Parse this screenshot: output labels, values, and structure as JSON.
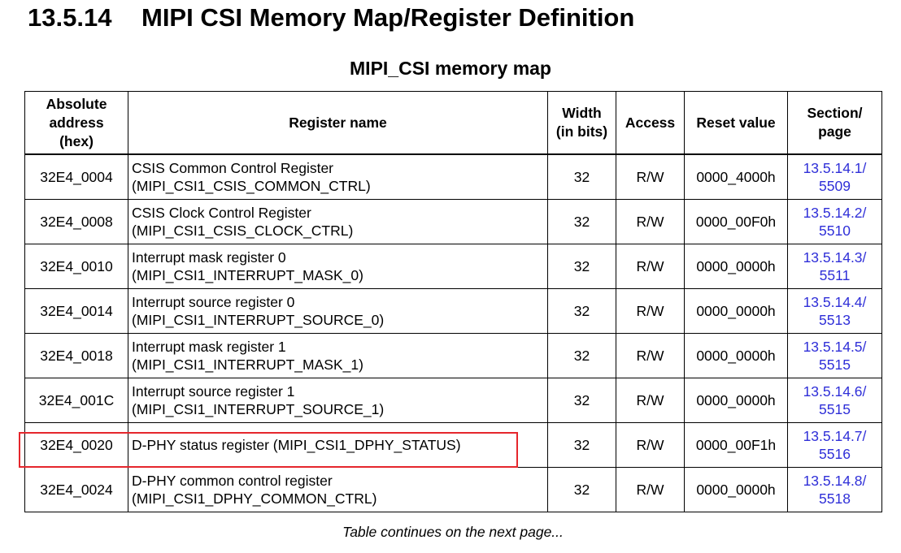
{
  "heading": {
    "number": "13.5.14",
    "title": "MIPI CSI Memory Map/Register Definition"
  },
  "table": {
    "caption": "MIPI_CSI memory map",
    "headers": {
      "address": [
        "Absolute",
        "address",
        "(hex)"
      ],
      "name": "Register name",
      "width": [
        "Width",
        "(in bits)"
      ],
      "access": "Access",
      "reset": "Reset value",
      "section": [
        "Section/",
        "page"
      ]
    },
    "rows": [
      {
        "address": "32E4_0004",
        "name": [
          "CSIS Common Control Register",
          "(MIPI_CSI1_CSIS_COMMON_CTRL)"
        ],
        "width": "32",
        "access": "R/W",
        "reset": "0000_4000h",
        "section": [
          "13.5.14.1/",
          "5509"
        ]
      },
      {
        "address": "32E4_0008",
        "name": [
          "CSIS Clock Control Register",
          "(MIPI_CSI1_CSIS_CLOCK_CTRL)"
        ],
        "width": "32",
        "access": "R/W",
        "reset": "0000_00F0h",
        "section": [
          "13.5.14.2/",
          "5510"
        ]
      },
      {
        "address": "32E4_0010",
        "name": [
          "Interrupt mask register 0",
          "(MIPI_CSI1_INTERRUPT_MASK_0)"
        ],
        "width": "32",
        "access": "R/W",
        "reset": "0000_0000h",
        "section": [
          "13.5.14.3/",
          "5511"
        ]
      },
      {
        "address": "32E4_0014",
        "name": [
          "Interrupt source register 0",
          "(MIPI_CSI1_INTERRUPT_SOURCE_0)"
        ],
        "width": "32",
        "access": "R/W",
        "reset": "0000_0000h",
        "section": [
          "13.5.14.4/",
          "5513"
        ]
      },
      {
        "address": "32E4_0018",
        "name": [
          "Interrupt mask register 1",
          "(MIPI_CSI1_INTERRUPT_MASK_1)"
        ],
        "width": "32",
        "access": "R/W",
        "reset": "0000_0000h",
        "section": [
          "13.5.14.5/",
          "5515"
        ]
      },
      {
        "address": "32E4_001C",
        "name": [
          "Interrupt source register 1",
          "(MIPI_CSI1_INTERRUPT_SOURCE_1)"
        ],
        "width": "32",
        "access": "R/W",
        "reset": "0000_0000h",
        "section": [
          "13.5.14.6/",
          "5515"
        ]
      },
      {
        "address": "32E4_0020",
        "name": [
          "D-PHY status register (MIPI_CSI1_DPHY_STATUS)"
        ],
        "width": "32",
        "access": "R/W",
        "reset": "0000_00F1h",
        "section": [
          "13.5.14.7/",
          "5516"
        ]
      },
      {
        "address": "32E4_0024",
        "name": [
          "D-PHY common control register",
          "(MIPI_CSI1_DPHY_COMMON_CTRL)"
        ],
        "width": "32",
        "access": "R/W",
        "reset": "0000_0000h",
        "section": [
          "13.5.14.8/",
          "5518"
        ]
      }
    ],
    "highlighted_row_address": "32E4_0020",
    "continuation_note": "Table continues on the next page..."
  },
  "colors": {
    "link": "#2f2fd8",
    "highlight": "#e5262c"
  }
}
